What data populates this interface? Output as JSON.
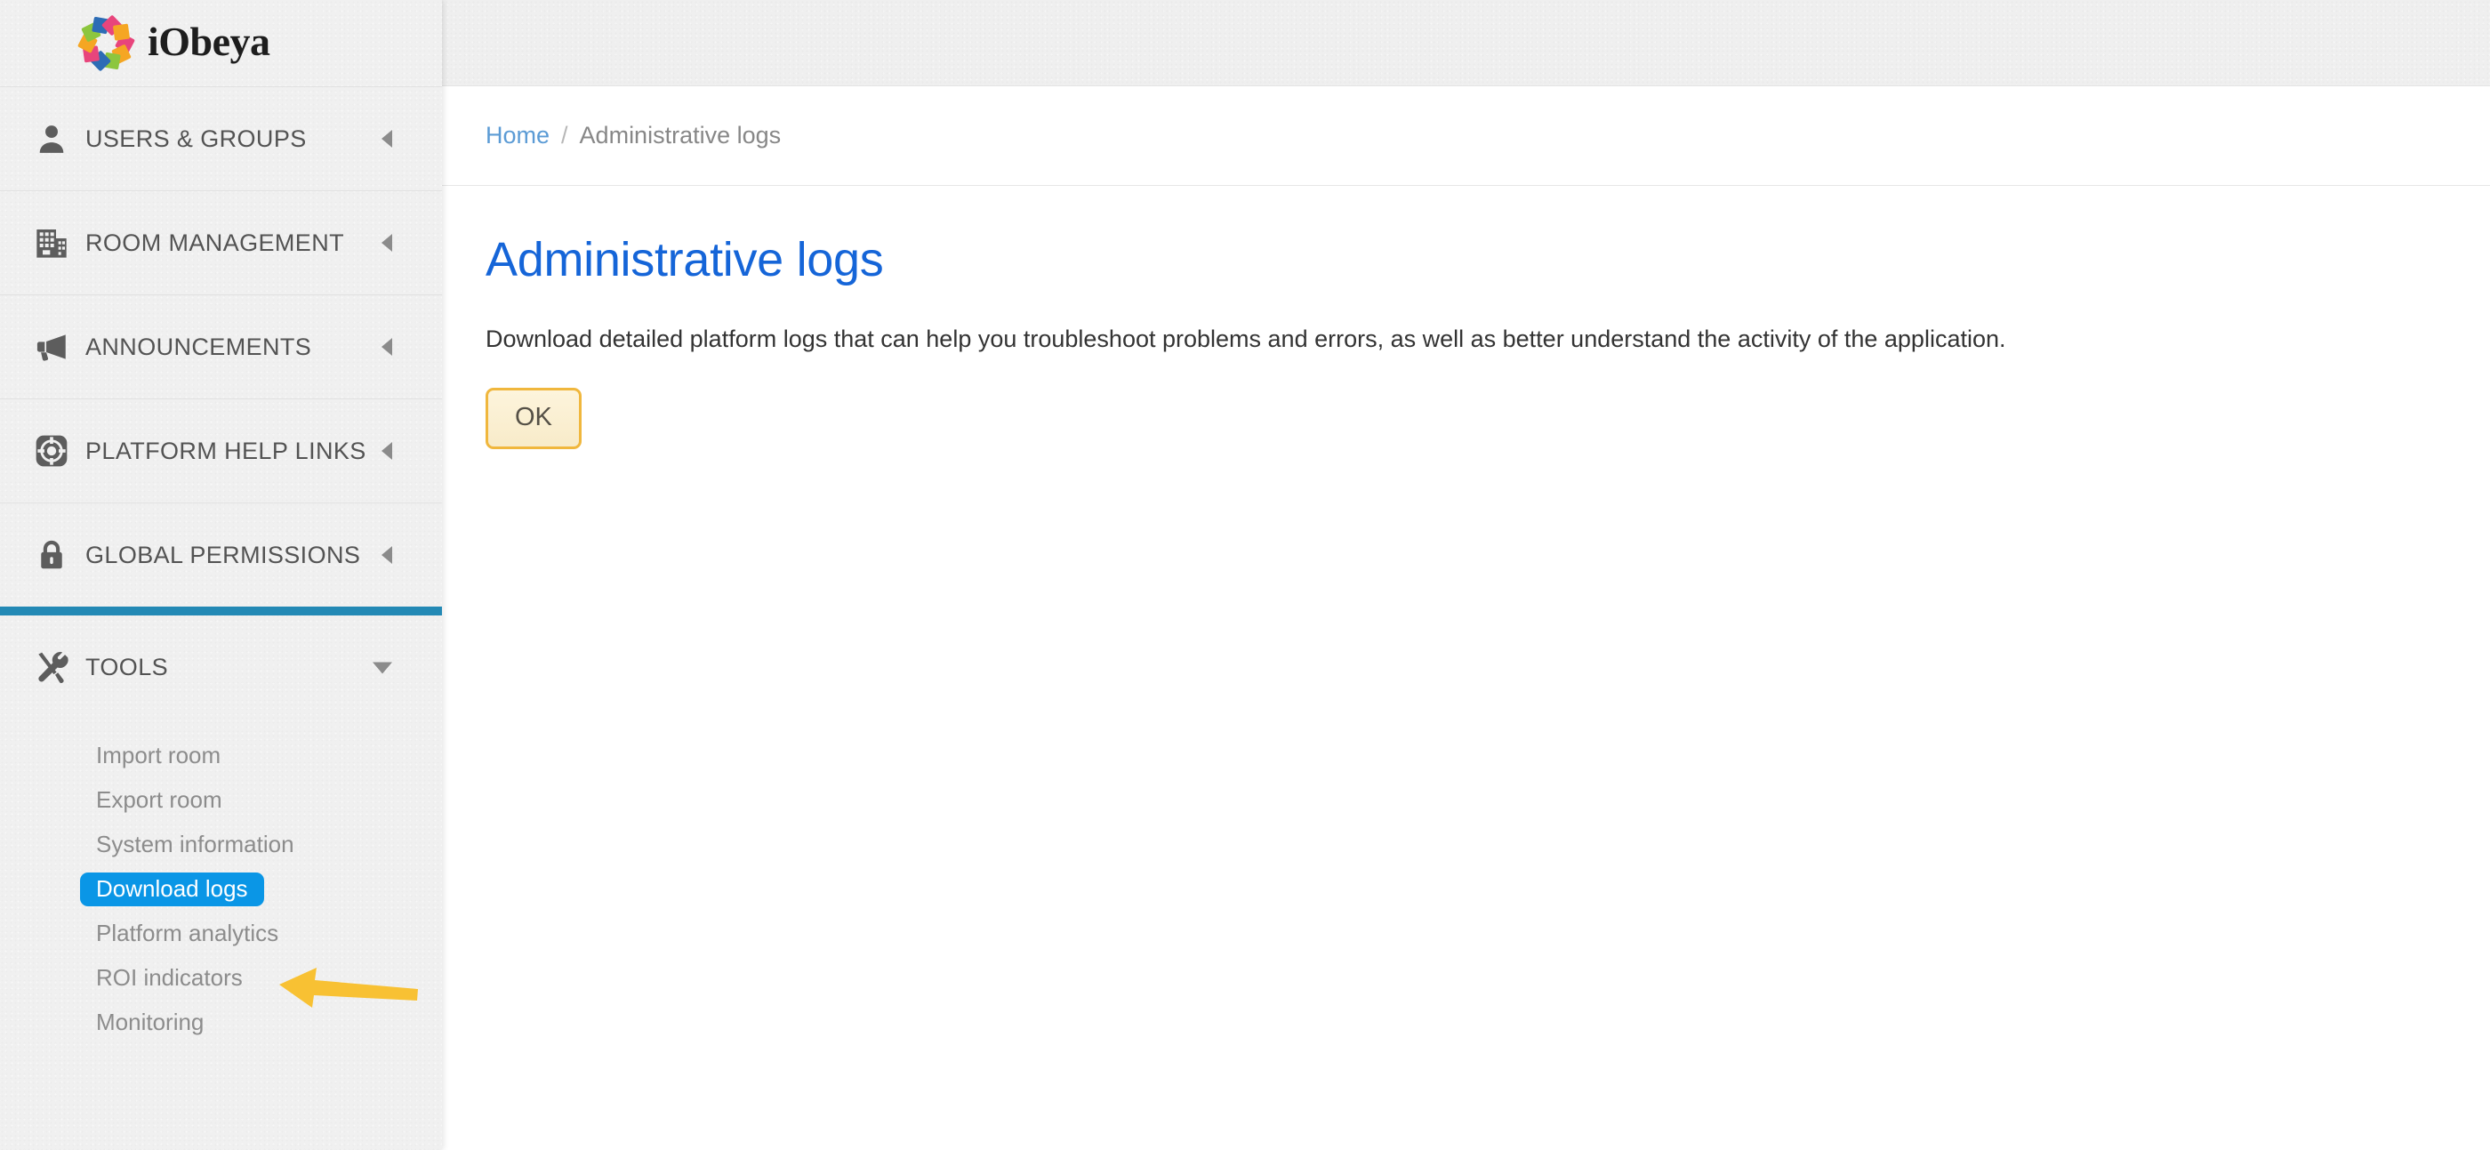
{
  "brand": {
    "name": "iObeya",
    "logo_icon": "iobeya-pinwheel-logo",
    "logo_colors": [
      "#e8457c",
      "#2c6cb5",
      "#8cc63e",
      "#f5a623"
    ]
  },
  "sidebar": {
    "items": [
      {
        "label": "USERS & GROUPS",
        "icon": "user-icon",
        "caret": "left"
      },
      {
        "label": "ROOM MANAGEMENT",
        "icon": "building-icon",
        "caret": "left"
      },
      {
        "label": "ANNOUNCEMENTS",
        "icon": "megaphone-icon",
        "caret": "left"
      },
      {
        "label": "PLATFORM HELP LINKS",
        "icon": "lifering-icon",
        "caret": "left"
      },
      {
        "label": "GLOBAL PERMISSIONS",
        "icon": "lock-icon",
        "caret": "left"
      },
      {
        "label": "TOOLS",
        "icon": "tools-icon",
        "caret": "down"
      }
    ],
    "tools_submenu": [
      {
        "label": "Import room",
        "active": false
      },
      {
        "label": "Export room",
        "active": false
      },
      {
        "label": "System information",
        "active": false
      },
      {
        "label": "Download logs",
        "active": true
      },
      {
        "label": "Platform analytics",
        "active": false
      },
      {
        "label": "ROI indicators",
        "active": false
      },
      {
        "label": "Monitoring",
        "active": false
      }
    ],
    "accent_color": "#2389b5",
    "active_pill_color": "#0a96e6"
  },
  "annotation": {
    "arrow_icon": "pointer-arrow-icon",
    "arrow_color": "#f8c133",
    "points_at": "Download logs"
  },
  "breadcrumb": {
    "home": "Home",
    "separator": "/",
    "current": "Administrative logs"
  },
  "main": {
    "title": "Administrative logs",
    "title_color": "#1565d8",
    "description": "Download detailed platform logs that can help you troubleshoot problems and errors, as well as better understand the activity of the application.",
    "ok_label": "OK",
    "ok_border_color": "#f0b73d"
  }
}
